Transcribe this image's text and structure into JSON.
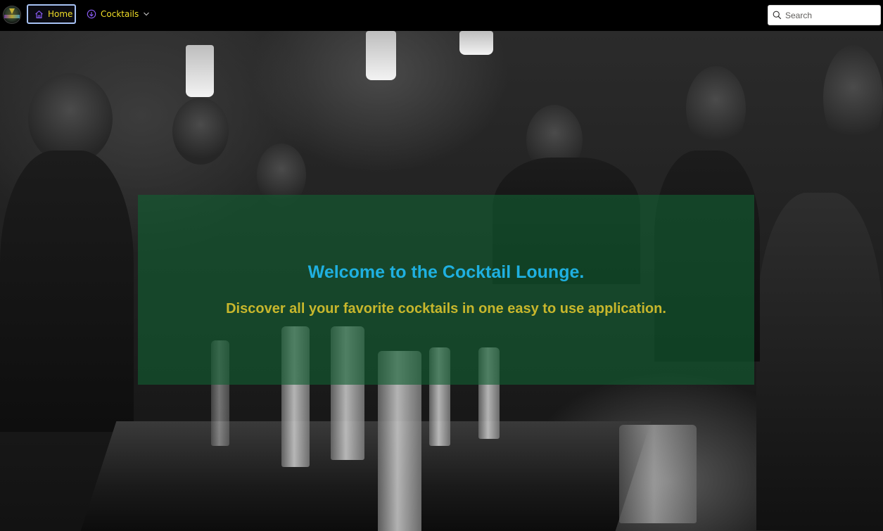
{
  "nav": {
    "home_label": "Home",
    "cocktails_label": "Cocktails",
    "logo_icon": "cocktail-logo-icon",
    "home_icon": "home-icon",
    "cocktails_icon": "circle-arrow-down-icon",
    "chevron_icon": "chevron-down-icon"
  },
  "search": {
    "placeholder": "Search",
    "value": "",
    "icon": "search-icon"
  },
  "hero": {
    "title": "Welcome to the Cocktail Lounge.",
    "subtitle": "Discover all your favorite cocktails in one easy to use application."
  },
  "colors": {
    "nav_background": "#000000",
    "nav_text": "#f2df27",
    "nav_icon": "#8a5cf6",
    "home_border": "#a7c2f4",
    "panel_background": "#126032",
    "title": "#1fb0e0",
    "subtitle": "#c8b72c"
  }
}
